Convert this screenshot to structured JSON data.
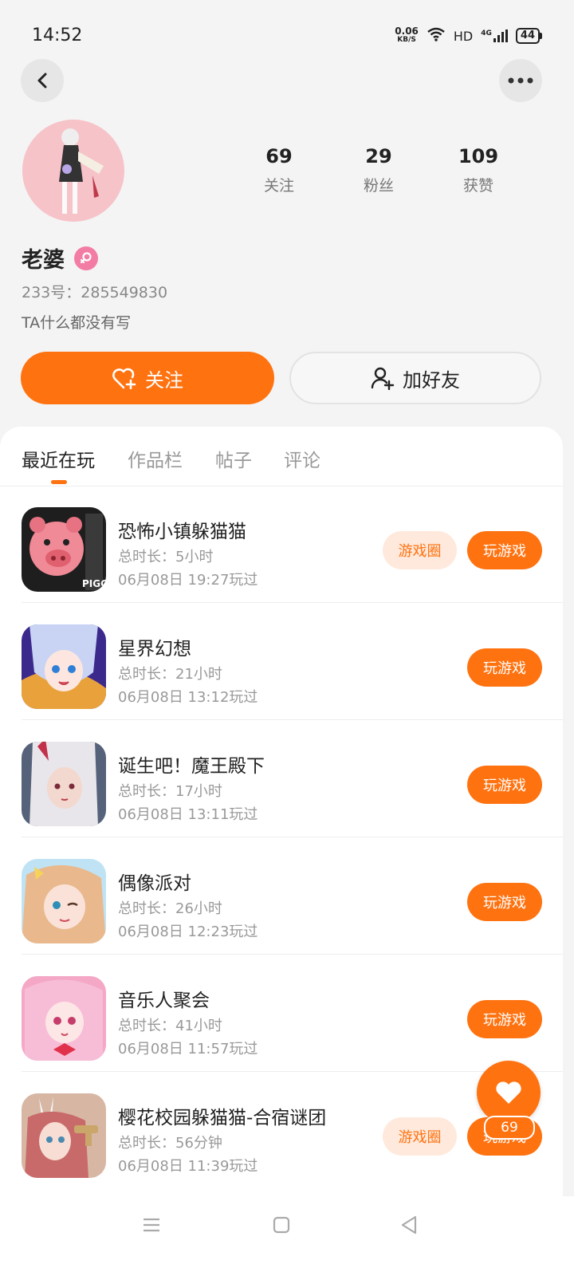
{
  "status_bar": {
    "time": "14:52",
    "net_speed_value": "0.06",
    "net_speed_unit": "KB/S",
    "network_label": "HD",
    "signal_label": "4G",
    "battery": "44"
  },
  "profile": {
    "stats": [
      {
        "value": "69",
        "label": "关注"
      },
      {
        "value": "29",
        "label": "粉丝"
      },
      {
        "value": "109",
        "label": "获赞"
      }
    ],
    "name": "老婆",
    "gender_icon": "female-icon",
    "user_id": "233号：285549830",
    "bio": "TA什么都没有写",
    "follow_label": "关注",
    "add_friend_label": "加好友"
  },
  "tabs": [
    {
      "label": "最近在玩",
      "active": true
    },
    {
      "label": "作品栏",
      "active": false
    },
    {
      "label": "帖子",
      "active": false
    },
    {
      "label": "评论",
      "active": false
    }
  ],
  "games": [
    {
      "name": "恐怖小镇躲猫猫",
      "duration": "总时长：5小时",
      "last_played": "06月08日 19:27玩过",
      "circle_label": "游戏圈",
      "play_label": "玩游戏",
      "icon_label": "PIGGY"
    },
    {
      "name": "星界幻想",
      "duration": "总时长：21小时",
      "last_played": "06月08日 13:12玩过",
      "play_label": "玩游戏"
    },
    {
      "name": "诞生吧！魔王殿下",
      "duration": "总时长：17小时",
      "last_played": "06月08日 13:11玩过",
      "play_label": "玩游戏"
    },
    {
      "name": "偶像派对",
      "duration": "总时长：26小时",
      "last_played": "06月08日 12:23玩过",
      "play_label": "玩游戏"
    },
    {
      "name": "音乐人聚会",
      "duration": "总时长：41小时",
      "last_played": "06月08日 11:57玩过",
      "play_label": "玩游戏"
    },
    {
      "name": "樱花校园躲猫猫-合宿谜团",
      "duration": "总时长：56分钟",
      "last_played": "06月08日 11:39玩过",
      "circle_label": "游戏圈",
      "play_label": "玩游戏"
    }
  ],
  "like_fab": {
    "count": "69"
  },
  "colors": {
    "accent": "#ff7210",
    "accent_light": "#ffe9dc",
    "female_badge": "#f27ca4"
  }
}
